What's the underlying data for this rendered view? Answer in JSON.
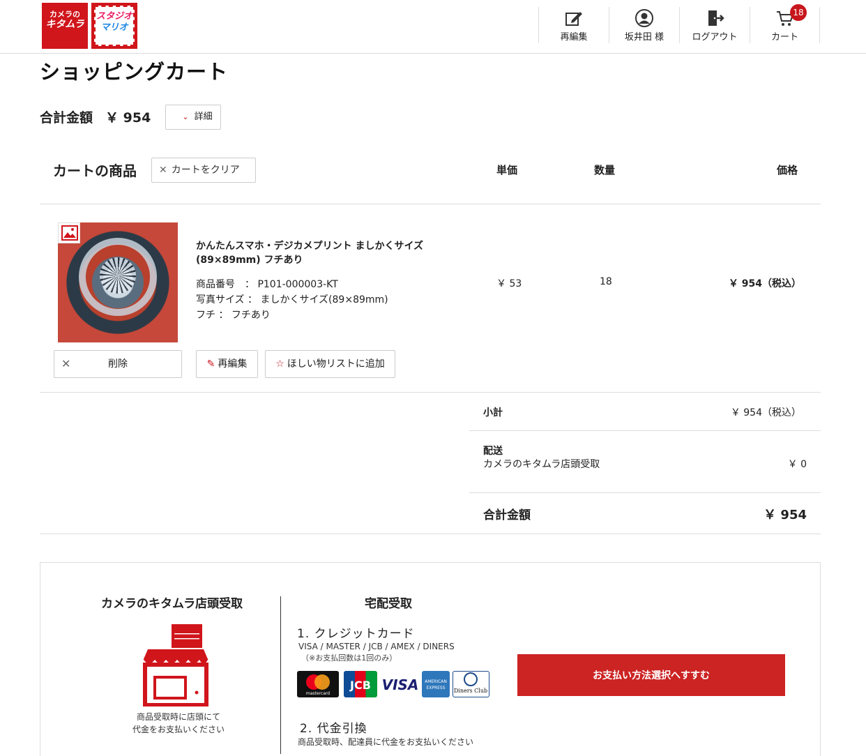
{
  "header": {
    "logo_kitamura_line1": "カメラの",
    "logo_kitamura_line2": "キタムラ",
    "logo_studio_line1": "スタジオ",
    "logo_studio_line2": "マリオ",
    "nav": [
      {
        "label": "再編集",
        "icon": "edit-icon"
      },
      {
        "label": "坂井田 様",
        "icon": "user-icon"
      },
      {
        "label": "ログアウト",
        "icon": "logout-icon"
      },
      {
        "label": "カート",
        "icon": "cart-icon",
        "badge": "18"
      }
    ]
  },
  "page_title": "ショッピングカート",
  "total_top": {
    "label": "合計金額",
    "amount": "￥ 954",
    "detail_label": "詳細"
  },
  "cart": {
    "title": "カートの商品",
    "clear_label": "カートをクリア",
    "columns": {
      "unit_price": "単価",
      "qty": "数量",
      "price": "価格"
    },
    "item": {
      "name_line1": "かんたんスマホ・デジカメプリント ましかくサイズ",
      "name_line2": "(89×89mm) フチあり",
      "specs": [
        "商品番号　：  P101-000003-KT",
        "写真サイズ  ：  ましかくサイズ(89×89mm)",
        "フチ  ：  フチあり"
      ],
      "unit_price": "￥ 53",
      "qty": "18",
      "price": "￥ 954（税込）",
      "delete_label": "削除",
      "reedit_label": "再編集",
      "wishlist_label": "ほしい物リストに追加"
    }
  },
  "summary": {
    "subtotal_label": "小計",
    "subtotal_value": "￥ 954（税込）",
    "shipping_label": "配送",
    "shipping_method": "カメラのキタムラ店頭受取",
    "shipping_value": "￥ 0",
    "total_label": "合計金額",
    "total_value": "￥ 954"
  },
  "payment": {
    "store_heading": "カメラのキタムラ店頭受取",
    "store_note_line1": "商品受取時に店頭にて",
    "store_note_line2": "代金をお支払いください",
    "delivery_heading": "宅配受取",
    "credit_heading": "1. クレジットカード",
    "credit_brands": "VISA / MASTER / JCB / AMEX / DINERS",
    "credit_note": "（※お支払回数は1回のみ）",
    "cards": [
      "mastercard",
      "JCB",
      "VISA",
      "AMERICAN EXPRESS",
      "Diners Club"
    ],
    "cod_heading": "2. 代金引換",
    "cod_note": "商品受取時、配達員に代金をお支払いください",
    "proceed_label": "お支払い方法選択へすすむ"
  },
  "colors": {
    "brand_red": "#cc2323",
    "badge_red": "#c8161d",
    "border": "#dddddd"
  }
}
